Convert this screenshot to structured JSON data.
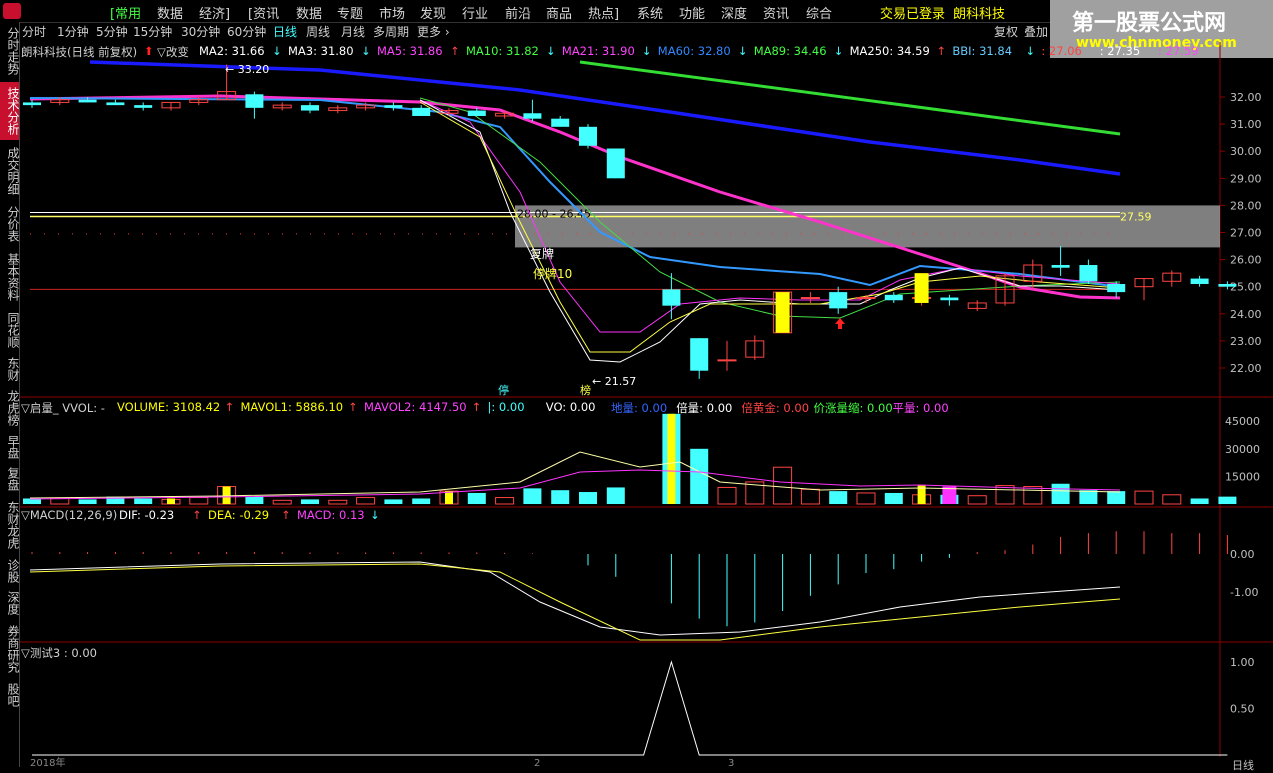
{
  "menubar": {
    "items": [
      "[常用",
      "数据",
      "经济]",
      "[资讯",
      "数据",
      "专题",
      "市场",
      "发现",
      "行业",
      "前沿",
      "商品",
      "热点]",
      "系统",
      "功能",
      "深度",
      "资讯",
      "综合"
    ],
    "login_status": "交易已登录",
    "stock_name": "朗科科技"
  },
  "tabs": [
    "分时",
    "1分钟",
    "5分钟",
    "15分钟",
    "30分钟",
    "60分钟",
    "日线",
    "周线",
    "月线",
    "多周期",
    "更多"
  ],
  "right_buttons": [
    "复权",
    "叠加"
  ],
  "left_nav": [
    "分时走势",
    "技术分析",
    "成交明细",
    "分价表",
    "基本资料",
    "同花顺",
    "东财",
    "龙虎榜",
    "早盘",
    "复盘",
    "东财龙虎",
    "诊股",
    "深度",
    "券商研究",
    "股吧"
  ],
  "watermark": {
    "title": "第一股票公式网",
    "url": "www.chnmoney.com"
  },
  "main_panel": {
    "title": "朗科科技(日线 前复权)",
    "change_label": "▽改变",
    "indicators": [
      {
        "label": "MA2: 31.66",
        "color": "#ffffff",
        "arrow": "↓"
      },
      {
        "label": "MA3: 31.80",
        "color": "#ffffff",
        "arrow": "↓"
      },
      {
        "label": "MA5: 31.86",
        "color": "#ff44ff",
        "arrow": "↑"
      },
      {
        "label": "MA10: 31.82",
        "color": "#44ff44",
        "arrow": "↓"
      },
      {
        "label": "MA21: 31.90",
        "color": "#ff44ff",
        "arrow": "↓"
      },
      {
        "label": "MA60: 32.80",
        "color": "#3388ff",
        "arrow": "↓"
      },
      {
        "label": "MA89: 34.46",
        "color": "#44ff44",
        "arrow": "↓"
      },
      {
        "label": "MA250: 34.59",
        "color": "#ffffff",
        "arrow": "↑"
      },
      {
        "label": "BBI: 31.84",
        "color": "#66ccff",
        "arrow": "↓"
      },
      {
        "label": ": 27.06",
        "color": "#ff4444",
        "arrow": ""
      },
      {
        "label": ": 27.35",
        "color": "#ffffff",
        "arrow": ""
      },
      {
        "label": ": 27.59",
        "color": "#ff44ff",
        "arrow": ""
      }
    ],
    "high_label": "33.20",
    "low_label": "21.57",
    "zone_label": "28.00 - 26.45",
    "zone_line_label": "27.59",
    "resume_label": "复牌",
    "suspend_label": "停牌10",
    "tag_ting": "停",
    "tag_bang": "榜",
    "y_ticks": [
      "32.00",
      "31.00",
      "30.00",
      "29.00",
      "28.00",
      "27.00",
      "26.00",
      "25.00",
      "24.00",
      "23.00",
      "22.00"
    ]
  },
  "volume_panel": {
    "prefix": "▽启量_ VVOL: -",
    "indicators": [
      {
        "label": "VOLUME: 3108.42",
        "color": "#ffff00",
        "arrow": "↑"
      },
      {
        "label": "MAVOL1: 5886.10",
        "color": "#ffff00",
        "arrow": "↑"
      },
      {
        "label": "MAVOL2: 4147.50",
        "color": "#ff44ff",
        "arrow": "↑"
      },
      {
        "label": "|: 0.00",
        "color": "#44ffff",
        "arrow": ""
      },
      {
        "label": "VO: 0.00",
        "color": "#ffffff",
        "arrow": ""
      },
      {
        "label": "地量: 0.00",
        "color": "#3366ff",
        "arrow": ""
      },
      {
        "label": "倍量: 0.00",
        "color": "#ffffff",
        "arrow": ""
      },
      {
        "label": "倍黄金: 0.00",
        "color": "#ff4444",
        "arrow": ""
      },
      {
        "label": "价涨量缩: 0.00",
        "color": "#44ff44",
        "arrow": ""
      },
      {
        "label": "平量: 0.00",
        "color": "#ff44ff",
        "arrow": ""
      }
    ],
    "y_ticks": [
      "45000",
      "30000",
      "15000"
    ]
  },
  "macd_panel": {
    "prefix": "▽MACD(12,26,9)",
    "indicators": [
      {
        "label": "DIF: -0.23",
        "color": "#ffffff",
        "arrow": "↑"
      },
      {
        "label": "DEA: -0.29",
        "color": "#ffff00",
        "arrow": "↑"
      },
      {
        "label": "MACD: 0.13",
        "color": "#ff44ff",
        "arrow": "↓"
      }
    ],
    "y_ticks": [
      "0.00",
      "-1.00"
    ]
  },
  "test_panel": {
    "prefix": "▽测试3 : 0.00",
    "y_ticks": [
      "1.00",
      "0.50"
    ]
  },
  "x_axis": {
    "labels": [
      "2018年",
      "2",
      "3"
    ],
    "period": "日线"
  },
  "chart_data": {
    "type": "candlestick",
    "candles": [
      [
        31.8,
        31.9,
        31.6,
        31.7
      ],
      [
        31.8,
        32.0,
        31.7,
        31.9
      ],
      [
        31.9,
        32.0,
        31.8,
        31.8
      ],
      [
        31.8,
        31.9,
        31.7,
        31.7
      ],
      [
        31.7,
        31.8,
        31.5,
        31.6
      ],
      [
        31.6,
        31.8,
        31.5,
        31.8
      ],
      [
        31.8,
        32.0,
        31.7,
        31.9
      ],
      [
        31.9,
        33.2,
        31.9,
        32.2
      ],
      [
        32.1,
        32.2,
        31.2,
        31.6
      ],
      [
        31.6,
        31.8,
        31.5,
        31.7
      ],
      [
        31.7,
        31.8,
        31.4,
        31.5
      ],
      [
        31.5,
        31.7,
        31.4,
        31.6
      ],
      [
        31.6,
        31.8,
        31.5,
        31.7
      ],
      [
        31.7,
        31.8,
        31.5,
        31.6
      ],
      [
        31.6,
        31.7,
        31.3,
        31.3
      ],
      [
        31.4,
        31.6,
        31.3,
        31.5
      ],
      [
        31.5,
        31.6,
        31.3,
        31.3
      ],
      [
        31.3,
        31.5,
        31.2,
        31.4
      ],
      [
        31.4,
        31.9,
        31.1,
        31.2
      ],
      [
        31.2,
        31.3,
        30.9,
        30.9
      ],
      [
        30.9,
        31.0,
        30.1,
        30.2
      ],
      [
        30.1,
        30.1,
        29.0,
        29.0
      ],
      [
        null,
        null,
        null,
        null
      ],
      [
        24.9,
        25.5,
        23.8,
        24.3
      ],
      [
        23.1,
        23.1,
        21.6,
        21.9
      ],
      [
        22.3,
        23.0,
        21.9,
        22.3
      ],
      [
        22.4,
        23.2,
        22.3,
        23.0
      ],
      [
        23.3,
        24.8,
        23.3,
        24.8
      ],
      [
        24.6,
        24.8,
        24.4,
        24.6
      ],
      [
        24.8,
        25.0,
        24.0,
        24.2
      ],
      [
        24.6,
        24.7,
        24.4,
        24.6
      ],
      [
        24.7,
        24.8,
        24.4,
        24.5
      ],
      [
        24.6,
        24.7,
        24.3,
        24.6
      ],
      [
        24.6,
        24.7,
        24.3,
        24.5
      ],
      [
        24.2,
        24.5,
        24.1,
        24.4
      ],
      [
        24.4,
        25.5,
        24.3,
        25.4
      ],
      [
        25.2,
        26.0,
        24.9,
        25.8
      ],
      [
        25.8,
        26.5,
        25.4,
        25.7
      ],
      [
        25.8,
        26.0,
        25.1,
        25.2
      ],
      [
        25.1,
        25.2,
        24.6,
        24.8
      ],
      [
        25.0,
        25.3,
        24.5,
        25.3
      ],
      [
        25.2,
        25.6,
        25.0,
        25.5
      ],
      [
        25.3,
        25.4,
        25.0,
        25.1
      ],
      [
        25.1,
        25.2,
        24.9,
        25.0
      ]
    ],
    "volume": [
      3000,
      3200,
      2500,
      4000,
      3000,
      2500,
      3500,
      9500,
      4000,
      2000,
      2500,
      2000,
      3500,
      2500,
      3000,
      7000,
      6000,
      3500,
      8500,
      7500,
      6500,
      9000,
      3500,
      49000,
      30000,
      9000,
      12000,
      20000,
      8000,
      7000,
      6000,
      6000,
      5000,
      5000,
      4500,
      10000,
      9500,
      11000,
      7500,
      7000,
      7000,
      5000,
      3000,
      4000
    ],
    "ma_levels": {
      "MA60_start": 33.4,
      "MA60_end": 29.2,
      "MA89_start": 32.9,
      "MA89_end": 30.6,
      "zone_top": 28.0,
      "zone_bottom": 26.45,
      "zone_mid": 27.59
    },
    "macd_hist": [
      0.05,
      0.05,
      0.05,
      0.05,
      0.05,
      0.05,
      0.05,
      0.05,
      0.05,
      0.05,
      0.04,
      0.04,
      0.04,
      0.04,
      0.04,
      0.04,
      0.04,
      0.03,
      0.02,
      0.0,
      -0.3,
      -0.6,
      0,
      -1.3,
      -1.7,
      -1.9,
      -1.8,
      -1.5,
      -1.1,
      -0.8,
      -0.5,
      -0.4,
      -0.2,
      -0.1,
      0.05,
      0.1,
      0.25,
      0.45,
      0.55,
      0.6,
      0.6,
      0.55,
      0.55,
      0.5
    ],
    "test_signal": [
      0,
      0,
      0,
      0,
      0,
      0,
      0,
      0,
      0,
      0,
      0,
      0,
      0,
      0,
      0,
      0,
      0,
      0,
      0,
      0,
      0,
      0,
      0,
      1,
      0,
      0,
      0,
      0,
      0,
      0,
      0,
      0,
      0,
      0,
      0,
      0,
      0,
      0,
      0,
      0,
      0,
      0,
      0,
      0
    ]
  },
  "colors": {
    "up": "#ff4444",
    "down": "#44ffff",
    "bg": "#000000",
    "grid": "#8b0000",
    "active_nav": "#c8102e"
  }
}
